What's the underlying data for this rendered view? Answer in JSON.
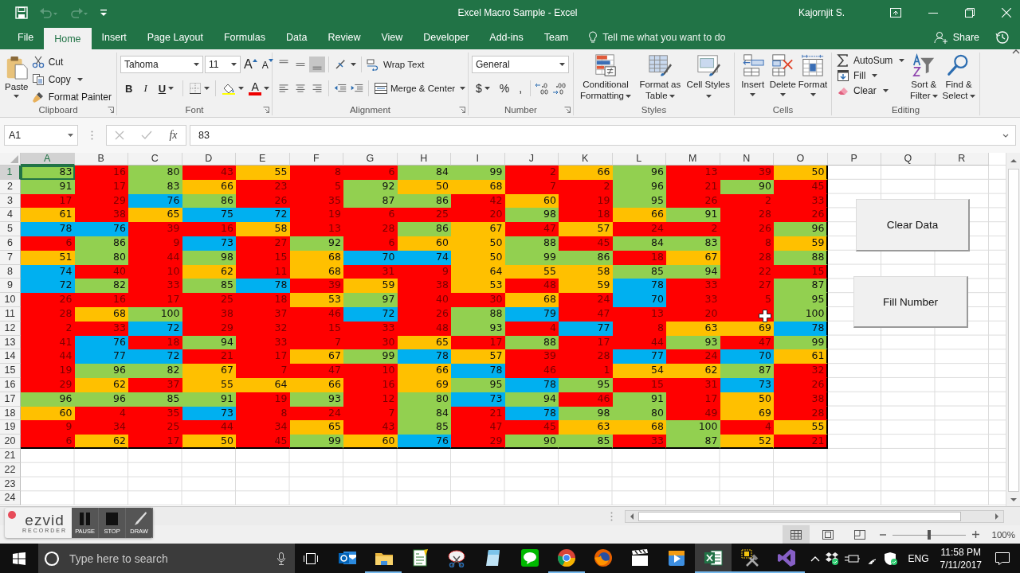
{
  "title_bar": {
    "title": "Excel Macro Sample  -  Excel",
    "user": "Kajornjit S."
  },
  "tabs": [
    {
      "label": "File",
      "selected": false
    },
    {
      "label": "Home",
      "selected": true
    },
    {
      "label": "Insert",
      "selected": false
    },
    {
      "label": "Page Layout",
      "selected": false
    },
    {
      "label": "Formulas",
      "selected": false
    },
    {
      "label": "Data",
      "selected": false
    },
    {
      "label": "Review",
      "selected": false
    },
    {
      "label": "View",
      "selected": false
    },
    {
      "label": "Developer",
      "selected": false
    },
    {
      "label": "Add-ins",
      "selected": false
    },
    {
      "label": "Team",
      "selected": false
    }
  ],
  "tell_me": {
    "placeholder": "Tell me what you want to do"
  },
  "share": "Share",
  "ribbon": {
    "clipboard": {
      "label": "Clipboard",
      "paste": "Paste",
      "cut": "Cut",
      "copy": "Copy",
      "format_painter": "Format Painter"
    },
    "font": {
      "label": "Font",
      "font_name": "Tahoma",
      "font_size": "11",
      "grow": "A",
      "shrink": "A",
      "bold": "B",
      "italic": "I",
      "underline": "U",
      "font_color": "A"
    },
    "alignment": {
      "label": "Alignment",
      "wrap_text": "Wrap Text",
      "merge_center": "Merge & Center"
    },
    "number": {
      "label": "Number",
      "format": "General",
      "currency": "$",
      "percent": "%",
      "comma": ","
    },
    "styles": {
      "label": "Styles",
      "buttons": [
        {
          "kind": "conditional",
          "label": "Conditional Formatting"
        },
        {
          "kind": "table",
          "label": "Format as Table"
        },
        {
          "kind": "cellstyles",
          "label": "Cell Styles"
        }
      ]
    },
    "cells": {
      "label": "Cells",
      "buttons": [
        {
          "kind": "insert",
          "label": "Insert"
        },
        {
          "kind": "delete",
          "label": "Delete"
        },
        {
          "kind": "format",
          "label": "Format"
        }
      ]
    },
    "editing": {
      "label": "Editing",
      "autosum": "AutoSum",
      "fill": "Fill",
      "clear": "Clear",
      "buttons": [
        {
          "kind": "sort",
          "label": "Sort & Filter"
        },
        {
          "kind": "find",
          "label": "Find & Select"
        }
      ]
    }
  },
  "formula_bar": {
    "name_box": "A1",
    "function_label": "fx",
    "value": "83"
  },
  "columns": [
    {
      "label": "A",
      "selected": true
    },
    {
      "label": "B",
      "selected": false
    },
    {
      "label": "C",
      "selected": false
    },
    {
      "label": "D",
      "selected": false
    },
    {
      "label": "E",
      "selected": false
    },
    {
      "label": "F",
      "selected": false
    },
    {
      "label": "G",
      "selected": false
    },
    {
      "label": "H",
      "selected": false
    },
    {
      "label": "I",
      "selected": false
    },
    {
      "label": "J",
      "selected": false
    },
    {
      "label": "K",
      "selected": false
    },
    {
      "label": "L",
      "selected": false
    },
    {
      "label": "M",
      "selected": false
    },
    {
      "label": "N",
      "selected": false
    },
    {
      "label": "O",
      "selected": false
    },
    {
      "label": "P",
      "selected": false
    },
    {
      "label": "Q",
      "selected": false
    },
    {
      "label": "R",
      "selected": false
    }
  ],
  "rows": [
    {
      "number": "1",
      "selected": true,
      "cells": [
        {
          "value": "83",
          "color": "#92d050",
          "selected": true
        },
        {
          "value": "16",
          "color": "#ff0000",
          "selected": false
        },
        {
          "value": "80",
          "color": "#92d050",
          "selected": false
        },
        {
          "value": "43",
          "color": "#ff0000",
          "selected": false
        },
        {
          "value": "55",
          "color": "#ffc000",
          "selected": false
        },
        {
          "value": "8",
          "color": "#ff0000",
          "selected": false
        },
        {
          "value": "6",
          "color": "#ff0000",
          "selected": false
        },
        {
          "value": "84",
          "color": "#92d050",
          "selected": false
        },
        {
          "value": "99",
          "color": "#92d050",
          "selected": false
        },
        {
          "value": "2",
          "color": "#ff0000",
          "selected": false
        },
        {
          "value": "66",
          "color": "#ffc000",
          "selected": false
        },
        {
          "value": "96",
          "color": "#92d050",
          "selected": false
        },
        {
          "value": "13",
          "color": "#ff0000",
          "selected": false
        },
        {
          "value": "39",
          "color": "#ff0000",
          "selected": false
        },
        {
          "value": "50",
          "color": "#ffc000",
          "selected": false
        }
      ]
    },
    {
      "number": "2",
      "selected": false,
      "cells": [
        {
          "value": "91",
          "color": "#92d050",
          "selected": false
        },
        {
          "value": "17",
          "color": "#ff0000",
          "selected": false
        },
        {
          "value": "83",
          "color": "#92d050",
          "selected": false
        },
        {
          "value": "66",
          "color": "#ffc000",
          "selected": false
        },
        {
          "value": "23",
          "color": "#ff0000",
          "selected": false
        },
        {
          "value": "5",
          "color": "#ff0000",
          "selected": false
        },
        {
          "value": "92",
          "color": "#92d050",
          "selected": false
        },
        {
          "value": "50",
          "color": "#ffc000",
          "selected": false
        },
        {
          "value": "68",
          "color": "#ffc000",
          "selected": false
        },
        {
          "value": "7",
          "color": "#ff0000",
          "selected": false
        },
        {
          "value": "2",
          "color": "#ff0000",
          "selected": false
        },
        {
          "value": "96",
          "color": "#92d050",
          "selected": false
        },
        {
          "value": "21",
          "color": "#ff0000",
          "selected": false
        },
        {
          "value": "90",
          "color": "#92d050",
          "selected": false
        },
        {
          "value": "45",
          "color": "#ff0000",
          "selected": false
        }
      ]
    },
    {
      "number": "3",
      "selected": false,
      "cells": [
        {
          "value": "17",
          "color": "#ff0000",
          "selected": false
        },
        {
          "value": "29",
          "color": "#ff0000",
          "selected": false
        },
        {
          "value": "76",
          "color": "#00b0f0",
          "selected": false
        },
        {
          "value": "86",
          "color": "#92d050",
          "selected": false
        },
        {
          "value": "26",
          "color": "#ff0000",
          "selected": false
        },
        {
          "value": "35",
          "color": "#ff0000",
          "selected": false
        },
        {
          "value": "87",
          "color": "#92d050",
          "selected": false
        },
        {
          "value": "86",
          "color": "#92d050",
          "selected": false
        },
        {
          "value": "42",
          "color": "#ff0000",
          "selected": false
        },
        {
          "value": "60",
          "color": "#ffc000",
          "selected": false
        },
        {
          "value": "19",
          "color": "#ff0000",
          "selected": false
        },
        {
          "value": "95",
          "color": "#92d050",
          "selected": false
        },
        {
          "value": "26",
          "color": "#ff0000",
          "selected": false
        },
        {
          "value": "2",
          "color": "#ff0000",
          "selected": false
        },
        {
          "value": "33",
          "color": "#ff0000",
          "selected": false
        }
      ]
    },
    {
      "number": "4",
      "selected": false,
      "cells": [
        {
          "value": "61",
          "color": "#ffc000",
          "selected": false
        },
        {
          "value": "38",
          "color": "#ff0000",
          "selected": false
        },
        {
          "value": "65",
          "color": "#ffc000",
          "selected": false
        },
        {
          "value": "75",
          "color": "#00b0f0",
          "selected": false
        },
        {
          "value": "72",
          "color": "#00b0f0",
          "selected": false
        },
        {
          "value": "19",
          "color": "#ff0000",
          "selected": false
        },
        {
          "value": "6",
          "color": "#ff0000",
          "selected": false
        },
        {
          "value": "25",
          "color": "#ff0000",
          "selected": false
        },
        {
          "value": "20",
          "color": "#ff0000",
          "selected": false
        },
        {
          "value": "98",
          "color": "#92d050",
          "selected": false
        },
        {
          "value": "18",
          "color": "#ff0000",
          "selected": false
        },
        {
          "value": "66",
          "color": "#ffc000",
          "selected": false
        },
        {
          "value": "91",
          "color": "#92d050",
          "selected": false
        },
        {
          "value": "28",
          "color": "#ff0000",
          "selected": false
        },
        {
          "value": "26",
          "color": "#ff0000",
          "selected": false
        }
      ]
    },
    {
      "number": "5",
      "selected": false,
      "cells": [
        {
          "value": "78",
          "color": "#00b0f0",
          "selected": false
        },
        {
          "value": "76",
          "color": "#00b0f0",
          "selected": false
        },
        {
          "value": "39",
          "color": "#ff0000",
          "selected": false
        },
        {
          "value": "16",
          "color": "#ff0000",
          "selected": false
        },
        {
          "value": "58",
          "color": "#ffc000",
          "selected": false
        },
        {
          "value": "13",
          "color": "#ff0000",
          "selected": false
        },
        {
          "value": "28",
          "color": "#ff0000",
          "selected": false
        },
        {
          "value": "86",
          "color": "#92d050",
          "selected": false
        },
        {
          "value": "67",
          "color": "#ffc000",
          "selected": false
        },
        {
          "value": "47",
          "color": "#ff0000",
          "selected": false
        },
        {
          "value": "57",
          "color": "#ffc000",
          "selected": false
        },
        {
          "value": "24",
          "color": "#ff0000",
          "selected": false
        },
        {
          "value": "2",
          "color": "#ff0000",
          "selected": false
        },
        {
          "value": "26",
          "color": "#ff0000",
          "selected": false
        },
        {
          "value": "96",
          "color": "#92d050",
          "selected": false
        }
      ]
    },
    {
      "number": "6",
      "selected": false,
      "cells": [
        {
          "value": "6",
          "color": "#ff0000",
          "selected": false
        },
        {
          "value": "86",
          "color": "#92d050",
          "selected": false
        },
        {
          "value": "9",
          "color": "#ff0000",
          "selected": false
        },
        {
          "value": "73",
          "color": "#00b0f0",
          "selected": false
        },
        {
          "value": "27",
          "color": "#ff0000",
          "selected": false
        },
        {
          "value": "92",
          "color": "#92d050",
          "selected": false
        },
        {
          "value": "6",
          "color": "#ff0000",
          "selected": false
        },
        {
          "value": "60",
          "color": "#ffc000",
          "selected": false
        },
        {
          "value": "50",
          "color": "#ffc000",
          "selected": false
        },
        {
          "value": "88",
          "color": "#92d050",
          "selected": false
        },
        {
          "value": "45",
          "color": "#ff0000",
          "selected": false
        },
        {
          "value": "84",
          "color": "#92d050",
          "selected": false
        },
        {
          "value": "83",
          "color": "#92d050",
          "selected": false
        },
        {
          "value": "8",
          "color": "#ff0000",
          "selected": false
        },
        {
          "value": "59",
          "color": "#ffc000",
          "selected": false
        }
      ]
    },
    {
      "number": "7",
      "selected": false,
      "cells": [
        {
          "value": "51",
          "color": "#ffc000",
          "selected": false
        },
        {
          "value": "80",
          "color": "#92d050",
          "selected": false
        },
        {
          "value": "44",
          "color": "#ff0000",
          "selected": false
        },
        {
          "value": "98",
          "color": "#92d050",
          "selected": false
        },
        {
          "value": "15",
          "color": "#ff0000",
          "selected": false
        },
        {
          "value": "68",
          "color": "#ffc000",
          "selected": false
        },
        {
          "value": "70",
          "color": "#00b0f0",
          "selected": false
        },
        {
          "value": "74",
          "color": "#00b0f0",
          "selected": false
        },
        {
          "value": "50",
          "color": "#ffc000",
          "selected": false
        },
        {
          "value": "99",
          "color": "#92d050",
          "selected": false
        },
        {
          "value": "86",
          "color": "#92d050",
          "selected": false
        },
        {
          "value": "18",
          "color": "#ff0000",
          "selected": false
        },
        {
          "value": "67",
          "color": "#ffc000",
          "selected": false
        },
        {
          "value": "28",
          "color": "#ff0000",
          "selected": false
        },
        {
          "value": "88",
          "color": "#92d050",
          "selected": false
        }
      ]
    },
    {
      "number": "8",
      "selected": false,
      "cells": [
        {
          "value": "74",
          "color": "#00b0f0",
          "selected": false
        },
        {
          "value": "40",
          "color": "#ff0000",
          "selected": false
        },
        {
          "value": "10",
          "color": "#ff0000",
          "selected": false
        },
        {
          "value": "62",
          "color": "#ffc000",
          "selected": false
        },
        {
          "value": "11",
          "color": "#ff0000",
          "selected": false
        },
        {
          "value": "68",
          "color": "#ffc000",
          "selected": false
        },
        {
          "value": "31",
          "color": "#ff0000",
          "selected": false
        },
        {
          "value": "9",
          "color": "#ff0000",
          "selected": false
        },
        {
          "value": "64",
          "color": "#ffc000",
          "selected": false
        },
        {
          "value": "55",
          "color": "#ffc000",
          "selected": false
        },
        {
          "value": "58",
          "color": "#ffc000",
          "selected": false
        },
        {
          "value": "85",
          "color": "#92d050",
          "selected": false
        },
        {
          "value": "94",
          "color": "#92d050",
          "selected": false
        },
        {
          "value": "22",
          "color": "#ff0000",
          "selected": false
        },
        {
          "value": "15",
          "color": "#ff0000",
          "selected": false
        }
      ]
    },
    {
      "number": "9",
      "selected": false,
      "cells": [
        {
          "value": "72",
          "color": "#00b0f0",
          "selected": false
        },
        {
          "value": "82",
          "color": "#92d050",
          "selected": false
        },
        {
          "value": "33",
          "color": "#ff0000",
          "selected": false
        },
        {
          "value": "85",
          "color": "#92d050",
          "selected": false
        },
        {
          "value": "78",
          "color": "#00b0f0",
          "selected": false
        },
        {
          "value": "39",
          "color": "#ff0000",
          "selected": false
        },
        {
          "value": "59",
          "color": "#ffc000",
          "selected": false
        },
        {
          "value": "38",
          "color": "#ff0000",
          "selected": false
        },
        {
          "value": "53",
          "color": "#ffc000",
          "selected": false
        },
        {
          "value": "48",
          "color": "#ff0000",
          "selected": false
        },
        {
          "value": "59",
          "color": "#ffc000",
          "selected": false
        },
        {
          "value": "78",
          "color": "#00b0f0",
          "selected": false
        },
        {
          "value": "33",
          "color": "#ff0000",
          "selected": false
        },
        {
          "value": "27",
          "color": "#ff0000",
          "selected": false
        },
        {
          "value": "87",
          "color": "#92d050",
          "selected": false
        }
      ]
    },
    {
      "number": "10",
      "selected": false,
      "cells": [
        {
          "value": "26",
          "color": "#ff0000",
          "selected": false
        },
        {
          "value": "16",
          "color": "#ff0000",
          "selected": false
        },
        {
          "value": "17",
          "color": "#ff0000",
          "selected": false
        },
        {
          "value": "25",
          "color": "#ff0000",
          "selected": false
        },
        {
          "value": "18",
          "color": "#ff0000",
          "selected": false
        },
        {
          "value": "53",
          "color": "#ffc000",
          "selected": false
        },
        {
          "value": "97",
          "color": "#92d050",
          "selected": false
        },
        {
          "value": "40",
          "color": "#ff0000",
          "selected": false
        },
        {
          "value": "30",
          "color": "#ff0000",
          "selected": false
        },
        {
          "value": "68",
          "color": "#ffc000",
          "selected": false
        },
        {
          "value": "24",
          "color": "#ff0000",
          "selected": false
        },
        {
          "value": "70",
          "color": "#00b0f0",
          "selected": false
        },
        {
          "value": "33",
          "color": "#ff0000",
          "selected": false
        },
        {
          "value": "5",
          "color": "#ff0000",
          "selected": false
        },
        {
          "value": "95",
          "color": "#92d050",
          "selected": false
        }
      ]
    },
    {
      "number": "11",
      "selected": false,
      "cells": [
        {
          "value": "28",
          "color": "#ff0000",
          "selected": false
        },
        {
          "value": "68",
          "color": "#ffc000",
          "selected": false
        },
        {
          "value": "100",
          "color": "#92d050",
          "selected": false
        },
        {
          "value": "38",
          "color": "#ff0000",
          "selected": false
        },
        {
          "value": "37",
          "color": "#ff0000",
          "selected": false
        },
        {
          "value": "46",
          "color": "#ff0000",
          "selected": false
        },
        {
          "value": "72",
          "color": "#00b0f0",
          "selected": false
        },
        {
          "value": "26",
          "color": "#ff0000",
          "selected": false
        },
        {
          "value": "88",
          "color": "#92d050",
          "selected": false
        },
        {
          "value": "79",
          "color": "#00b0f0",
          "selected": false
        },
        {
          "value": "47",
          "color": "#ff0000",
          "selected": false
        },
        {
          "value": "13",
          "color": "#ff0000",
          "selected": false
        },
        {
          "value": "20",
          "color": "#ff0000",
          "selected": false
        },
        {
          "color": "#ff0000",
          "selected": false
        },
        {
          "value": "100",
          "color": "#92d050",
          "selected": false
        }
      ]
    },
    {
      "number": "12",
      "selected": false,
      "cells": [
        {
          "value": "2",
          "color": "#ff0000",
          "selected": false
        },
        {
          "value": "33",
          "color": "#ff0000",
          "selected": false
        },
        {
          "value": "72",
          "color": "#00b0f0",
          "selected": false
        },
        {
          "value": "29",
          "color": "#ff0000",
          "selected": false
        },
        {
          "value": "32",
          "color": "#ff0000",
          "selected": false
        },
        {
          "value": "15",
          "color": "#ff0000",
          "selected": false
        },
        {
          "value": "33",
          "color": "#ff0000",
          "selected": false
        },
        {
          "value": "48",
          "color": "#ff0000",
          "selected": false
        },
        {
          "value": "93",
          "color": "#92d050",
          "selected": false
        },
        {
          "value": "4",
          "color": "#ff0000",
          "selected": false
        },
        {
          "value": "77",
          "color": "#00b0f0",
          "selected": false
        },
        {
          "value": "8",
          "color": "#ff0000",
          "selected": false
        },
        {
          "value": "63",
          "color": "#ffc000",
          "selected": false
        },
        {
          "value": "69",
          "color": "#ffc000",
          "selected": false
        },
        {
          "value": "78",
          "color": "#00b0f0",
          "selected": false
        }
      ]
    },
    {
      "number": "13",
      "selected": false,
      "cells": [
        {
          "value": "41",
          "color": "#ff0000",
          "selected": false
        },
        {
          "value": "76",
          "color": "#00b0f0",
          "selected": false
        },
        {
          "value": "18",
          "color": "#ff0000",
          "selected": false
        },
        {
          "value": "94",
          "color": "#92d050",
          "selected": false
        },
        {
          "value": "33",
          "color": "#ff0000",
          "selected": false
        },
        {
          "value": "7",
          "color": "#ff0000",
          "selected": false
        },
        {
          "value": "30",
          "color": "#ff0000",
          "selected": false
        },
        {
          "value": "65",
          "color": "#ffc000",
          "selected": false
        },
        {
          "value": "17",
          "color": "#ff0000",
          "selected": false
        },
        {
          "value": "88",
          "color": "#92d050",
          "selected": false
        },
        {
          "value": "17",
          "color": "#ff0000",
          "selected": false
        },
        {
          "value": "44",
          "color": "#ff0000",
          "selected": false
        },
        {
          "value": "93",
          "color": "#92d050",
          "selected": false
        },
        {
          "value": "47",
          "color": "#ff0000",
          "selected": false
        },
        {
          "value": "99",
          "color": "#92d050",
          "selected": false
        }
      ]
    },
    {
      "number": "14",
      "selected": false,
      "cells": [
        {
          "value": "44",
          "color": "#ff0000",
          "selected": false
        },
        {
          "value": "77",
          "color": "#00b0f0",
          "selected": false
        },
        {
          "value": "72",
          "color": "#00b0f0",
          "selected": false
        },
        {
          "value": "21",
          "color": "#ff0000",
          "selected": false
        },
        {
          "value": "17",
          "color": "#ff0000",
          "selected": false
        },
        {
          "value": "67",
          "color": "#ffc000",
          "selected": false
        },
        {
          "value": "99",
          "color": "#92d050",
          "selected": false
        },
        {
          "value": "78",
          "color": "#00b0f0",
          "selected": false
        },
        {
          "value": "57",
          "color": "#ffc000",
          "selected": false
        },
        {
          "value": "39",
          "color": "#ff0000",
          "selected": false
        },
        {
          "value": "28",
          "color": "#ff0000",
          "selected": false
        },
        {
          "value": "77",
          "color": "#00b0f0",
          "selected": false
        },
        {
          "value": "24",
          "color": "#ff0000",
          "selected": false
        },
        {
          "value": "70",
          "color": "#00b0f0",
          "selected": false
        },
        {
          "value": "61",
          "color": "#ffc000",
          "selected": false
        }
      ]
    },
    {
      "number": "15",
      "selected": false,
      "cells": [
        {
          "value": "19",
          "color": "#ff0000",
          "selected": false
        },
        {
          "value": "96",
          "color": "#92d050",
          "selected": false
        },
        {
          "value": "82",
          "color": "#92d050",
          "selected": false
        },
        {
          "value": "67",
          "color": "#ffc000",
          "selected": false
        },
        {
          "value": "7",
          "color": "#ff0000",
          "selected": false
        },
        {
          "value": "47",
          "color": "#ff0000",
          "selected": false
        },
        {
          "value": "10",
          "color": "#ff0000",
          "selected": false
        },
        {
          "value": "66",
          "color": "#ffc000",
          "selected": false
        },
        {
          "value": "78",
          "color": "#00b0f0",
          "selected": false
        },
        {
          "value": "46",
          "color": "#ff0000",
          "selected": false
        },
        {
          "value": "1",
          "color": "#ff0000",
          "selected": false
        },
        {
          "value": "54",
          "color": "#ffc000",
          "selected": false
        },
        {
          "value": "62",
          "color": "#ffc000",
          "selected": false
        },
        {
          "value": "87",
          "color": "#92d050",
          "selected": false
        },
        {
          "value": "32",
          "color": "#ff0000",
          "selected": false
        }
      ]
    },
    {
      "number": "16",
      "selected": false,
      "cells": [
        {
          "value": "29",
          "color": "#ff0000",
          "selected": false
        },
        {
          "value": "62",
          "color": "#ffc000",
          "selected": false
        },
        {
          "value": "37",
          "color": "#ff0000",
          "selected": false
        },
        {
          "value": "55",
          "color": "#ffc000",
          "selected": false
        },
        {
          "value": "64",
          "color": "#ffc000",
          "selected": false
        },
        {
          "value": "66",
          "color": "#ffc000",
          "selected": false
        },
        {
          "value": "16",
          "color": "#ff0000",
          "selected": false
        },
        {
          "value": "69",
          "color": "#ffc000",
          "selected": false
        },
        {
          "value": "95",
          "color": "#92d050",
          "selected": false
        },
        {
          "value": "78",
          "color": "#00b0f0",
          "selected": false
        },
        {
          "value": "95",
          "color": "#92d050",
          "selected": false
        },
        {
          "value": "15",
          "color": "#ff0000",
          "selected": false
        },
        {
          "value": "31",
          "color": "#ff0000",
          "selected": false
        },
        {
          "value": "73",
          "color": "#00b0f0",
          "selected": false
        },
        {
          "value": "26",
          "color": "#ff0000",
          "selected": false
        }
      ]
    },
    {
      "number": "17",
      "selected": false,
      "cells": [
        {
          "value": "96",
          "color": "#92d050",
          "selected": false
        },
        {
          "value": "96",
          "color": "#92d050",
          "selected": false
        },
        {
          "value": "85",
          "color": "#92d050",
          "selected": false
        },
        {
          "value": "91",
          "color": "#92d050",
          "selected": false
        },
        {
          "value": "19",
          "color": "#ff0000",
          "selected": false
        },
        {
          "value": "93",
          "color": "#92d050",
          "selected": false
        },
        {
          "value": "12",
          "color": "#ff0000",
          "selected": false
        },
        {
          "value": "80",
          "color": "#92d050",
          "selected": false
        },
        {
          "value": "73",
          "color": "#00b0f0",
          "selected": false
        },
        {
          "value": "94",
          "color": "#92d050",
          "selected": false
        },
        {
          "value": "46",
          "color": "#ff0000",
          "selected": false
        },
        {
          "value": "91",
          "color": "#92d050",
          "selected": false
        },
        {
          "value": "17",
          "color": "#ff0000",
          "selected": false
        },
        {
          "value": "50",
          "color": "#ffc000",
          "selected": false
        },
        {
          "value": "38",
          "color": "#ff0000",
          "selected": false
        }
      ]
    },
    {
      "number": "18",
      "selected": false,
      "cells": [
        {
          "value": "60",
          "color": "#ffc000",
          "selected": false
        },
        {
          "value": "4",
          "color": "#ff0000",
          "selected": false
        },
        {
          "value": "35",
          "color": "#ff0000",
          "selected": false
        },
        {
          "value": "73",
          "color": "#00b0f0",
          "selected": false
        },
        {
          "value": "8",
          "color": "#ff0000",
          "selected": false
        },
        {
          "value": "24",
          "color": "#ff0000",
          "selected": false
        },
        {
          "value": "7",
          "color": "#ff0000",
          "selected": false
        },
        {
          "value": "84",
          "color": "#92d050",
          "selected": false
        },
        {
          "value": "21",
          "color": "#ff0000",
          "selected": false
        },
        {
          "value": "78",
          "color": "#00b0f0",
          "selected": false
        },
        {
          "value": "98",
          "color": "#92d050",
          "selected": false
        },
        {
          "value": "80",
          "color": "#92d050",
          "selected": false
        },
        {
          "value": "49",
          "color": "#ff0000",
          "selected": false
        },
        {
          "value": "69",
          "color": "#ffc000",
          "selected": false
        },
        {
          "value": "28",
          "color": "#ff0000",
          "selected": false
        }
      ]
    },
    {
      "number": "19",
      "selected": false,
      "cells": [
        {
          "value": "9",
          "color": "#ff0000",
          "selected": false
        },
        {
          "value": "34",
          "color": "#ff0000",
          "selected": false
        },
        {
          "value": "25",
          "color": "#ff0000",
          "selected": false
        },
        {
          "value": "44",
          "color": "#ff0000",
          "selected": false
        },
        {
          "value": "34",
          "color": "#ff0000",
          "selected": false
        },
        {
          "value": "65",
          "color": "#ffc000",
          "selected": false
        },
        {
          "value": "43",
          "color": "#ff0000",
          "selected": false
        },
        {
          "value": "85",
          "color": "#92d050",
          "selected": false
        },
        {
          "value": "47",
          "color": "#ff0000",
          "selected": false
        },
        {
          "value": "45",
          "color": "#ff0000",
          "selected": false
        },
        {
          "value": "63",
          "color": "#ffc000",
          "selected": false
        },
        {
          "value": "68",
          "color": "#ffc000",
          "selected": false
        },
        {
          "value": "100",
          "color": "#92d050",
          "selected": false
        },
        {
          "value": "4",
          "color": "#ff0000",
          "selected": false
        },
        {
          "value": "55",
          "color": "#ffc000",
          "selected": false
        }
      ]
    },
    {
      "number": "20",
      "selected": false,
      "cells": [
        {
          "value": "6",
          "color": "#ff0000",
          "selected": false
        },
        {
          "value": "62",
          "color": "#ffc000",
          "selected": false
        },
        {
          "value": "17",
          "color": "#ff0000",
          "selected": false
        },
        {
          "value": "50",
          "color": "#ffc000",
          "selected": false
        },
        {
          "value": "45",
          "color": "#ff0000",
          "selected": false
        },
        {
          "value": "99",
          "color": "#92d050",
          "selected": false
        },
        {
          "value": "60",
          "color": "#ffc000",
          "selected": false
        },
        {
          "value": "76",
          "color": "#00b0f0",
          "selected": false
        },
        {
          "value": "29",
          "color": "#ff0000",
          "selected": false
        },
        {
          "value": "90",
          "color": "#92d050",
          "selected": false
        },
        {
          "value": "85",
          "color": "#92d050",
          "selected": false
        },
        {
          "value": "33",
          "color": "#ff0000",
          "selected": false
        },
        {
          "value": "87",
          "color": "#92d050",
          "selected": false
        },
        {
          "value": "52",
          "color": "#ffc000",
          "selected": false
        },
        {
          "value": "21",
          "color": "#ff0000",
          "selected": false
        }
      ]
    },
    {
      "number": "21",
      "selected": false
    },
    {
      "number": "22",
      "selected": false
    },
    {
      "number": "23",
      "selected": false
    },
    {
      "number": "24",
      "selected": false
    }
  ],
  "sheet_buttons": [
    "Clear Data",
    "Fill Number"
  ],
  "recorder": {
    "logo": "ezvid",
    "subtitle": "RECORDER",
    "buttons": [
      {
        "kind": "pause",
        "label": "PAUSE"
      },
      {
        "kind": "stop",
        "label": "STOP"
      },
      {
        "kind": "draw",
        "label": "DRAW"
      }
    ]
  },
  "status_bar": {
    "views": [
      {
        "kind": "normal",
        "selected": true
      },
      {
        "kind": "page_layout",
        "selected": false
      },
      {
        "kind": "page_break",
        "selected": false
      }
    ],
    "zoom": {
      "level": 0.5,
      "reading": "100%"
    }
  },
  "taskbar": {
    "search": {
      "placeholder": "Type here to search"
    },
    "apps": [
      {
        "kind": "mail",
        "running": false,
        "selected": false
      },
      {
        "kind": "folder",
        "running": true,
        "selected": false
      },
      {
        "kind": "editor",
        "running": false,
        "selected": false
      },
      {
        "kind": "scissors",
        "running": false,
        "selected": false
      },
      {
        "kind": "notepad",
        "running": false,
        "selected": false
      },
      {
        "kind": "chat",
        "running": false,
        "selected": false
      },
      {
        "kind": "ball",
        "running": true,
        "selected": false
      },
      {
        "kind": "fox",
        "running": false,
        "selected": false
      },
      {
        "kind": "clapper",
        "running": false,
        "selected": false
      },
      {
        "kind": "player",
        "running": false,
        "selected": false
      },
      {
        "kind": "sheet",
        "running": true,
        "selected": true
      },
      {
        "kind": "tools",
        "running": true,
        "selected": false
      },
      {
        "kind": "code",
        "running": true,
        "selected": false
      }
    ],
    "tray": {
      "language": "ENG",
      "time": "11:58 PM",
      "date": "7/11/2017"
    }
  }
}
